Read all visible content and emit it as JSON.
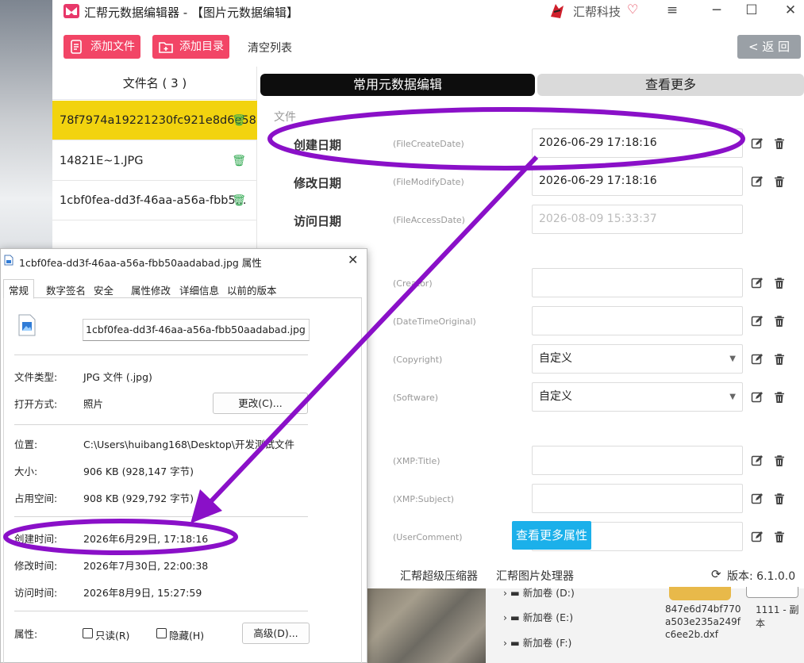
{
  "app": {
    "title": "汇帮元数据编辑器 - 【图片元数据编辑】",
    "brand": "汇帮科技",
    "win_min": "─",
    "win_menu": "≡",
    "win_max": "☐",
    "win_close": "✕"
  },
  "toolbar": {
    "add_file": "添加文件",
    "add_dir": "添加目录",
    "clear": "清空列表",
    "back": "< 返 回"
  },
  "file_list": {
    "header": "文件名 ( 3 )",
    "items": [
      {
        "name": "78f7974a19221230fc921e8d6e58..."
      },
      {
        "name": "14821E~1.JPG"
      },
      {
        "name": "1cbf0fea-dd3f-46aa-a56a-fbb5..."
      }
    ]
  },
  "tabs": {
    "common": "常用元数据编辑",
    "more": "查看更多"
  },
  "section_file": "文件",
  "fields": [
    {
      "label": "创建日期",
      "key": "(FileCreateDate)",
      "value": "2026-06-29 17:18:16"
    },
    {
      "label": "修改日期",
      "key": "(FileModifyDate)",
      "value": "2026-06-29 17:18:16"
    },
    {
      "label": "访问日期",
      "key": "(FileAccessDate)",
      "value": "2026-08-09 15:33:37"
    },
    {
      "label": "",
      "key": "(Creator)",
      "value": ""
    },
    {
      "label": "",
      "key": "(DateTimeOriginal)",
      "value": ""
    },
    {
      "label": "",
      "key": "(Copyright)",
      "value": "自定义"
    },
    {
      "label": "",
      "key": "(Software)",
      "value": "自定义"
    },
    {
      "label": "",
      "key": "(XMP:Title)",
      "value": ""
    },
    {
      "label": "",
      "key": "(XMP:Subject)",
      "value": ""
    },
    {
      "label": "",
      "key": "(UserComment)",
      "value": ""
    }
  ],
  "more_props_btn": "查看更多属性",
  "bottom": {
    "compress": "汇帮超级压缩器",
    "image_proc": "汇帮图片处理器",
    "version": "版本:  6.1.0.0"
  },
  "explorer": {
    "drives": [
      "新加卷 (D:)",
      "新加卷 (E:)",
      "新加卷 (F:)"
    ],
    "file1": [
      "847e6d74bf770",
      "a503e235a249f",
      "c6ee2b.dxf"
    ],
    "file2": "1111 - 副本"
  },
  "dialog": {
    "title": "1cbf0fea-dd3f-46aa-a56a-fbb50aadabad.jpg 属性",
    "tabs": [
      "常规",
      "数字签名",
      "安全",
      "属性修改",
      "详细信息",
      "以前的版本"
    ],
    "filename": "1cbf0fea-dd3f-46aa-a56a-fbb50aadabad.jpg",
    "type_label": "文件类型:",
    "type_value": "JPG 文件 (.jpg)",
    "open_label": "打开方式:",
    "open_value": "照片",
    "change_btn": "更改(C)...",
    "loc_label": "位置:",
    "loc_value": "C:\\Users\\huibang168\\Desktop\\开发测试文件",
    "size_label": "大小:",
    "size_value": "906 KB (928,147 字节)",
    "disk_label": "占用空间:",
    "disk_value": "908 KB (929,792 字节)",
    "created_label": "创建时间:",
    "created_value": "2026年6月29日, 17:18:16",
    "modified_label": "修改时间:",
    "modified_value": "2026年7月30日, 22:00:38",
    "accessed_label": "访问时间:",
    "accessed_value": "2026年8月9日, 15:27:59",
    "attr_label": "属性:",
    "readonly": "只读(R)",
    "hidden": "隐藏(H)",
    "advanced_btn": "高级(D)..."
  },
  "colors": {
    "accent_red": "#f24566",
    "selected_yellow": "#f2d30f",
    "annotation_purple": "#8a10c8",
    "blue_button": "#1bb0ea"
  }
}
